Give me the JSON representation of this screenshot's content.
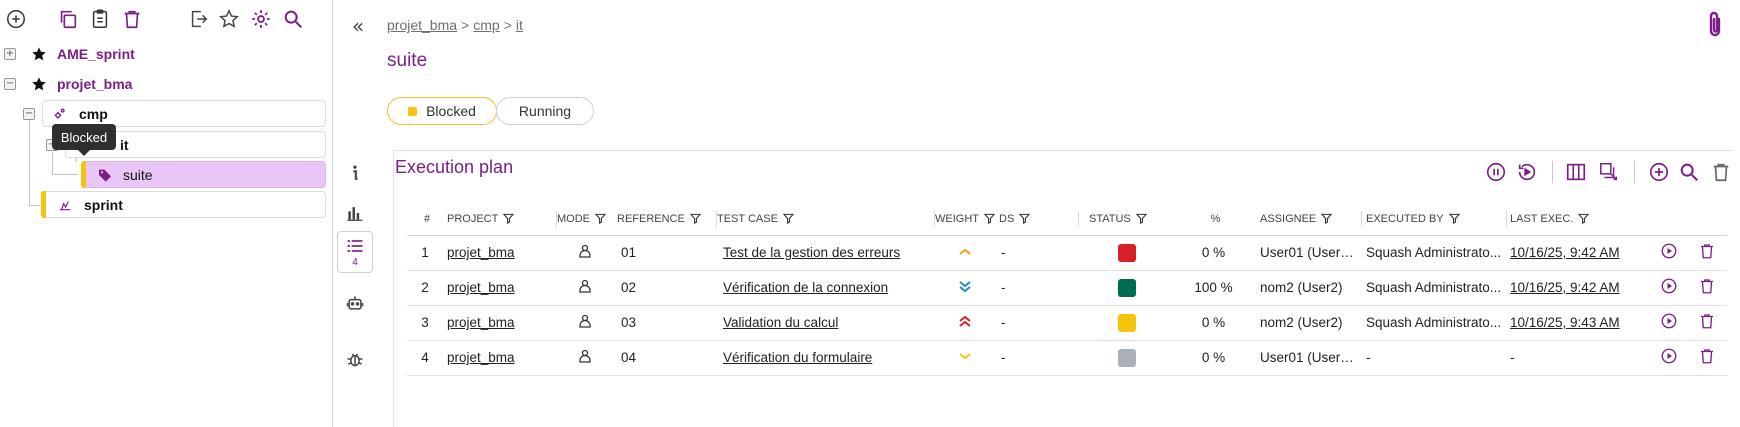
{
  "tree": {
    "projects": [
      {
        "name": "AME_sprint",
        "expander": "+"
      },
      {
        "name": "projet_bma",
        "expander": "−"
      }
    ],
    "nodes": {
      "cmp": "cmp",
      "it": "it",
      "suite": "suite",
      "sprint": "sprint"
    },
    "tooltip": "Blocked"
  },
  "breadcrumb": {
    "items": [
      "projet_bma",
      "cmp",
      "it"
    ],
    "separator": ">"
  },
  "page_title": "suite",
  "status_toggle": {
    "blocked": "Blocked",
    "running": "Running"
  },
  "side_nav": {
    "plan_count": "4"
  },
  "execution_plan": {
    "title": "Execution plan",
    "columns": {
      "num": "#",
      "project": "Project",
      "mode": "Mode",
      "reference": "Reference",
      "test_case": "Test case",
      "weight": "Weight",
      "ds": "DS",
      "status": "Status",
      "percent": "%",
      "assignee": "Assignee",
      "executed_by": "Executed by",
      "last_exec": "Last exec."
    },
    "rows": [
      {
        "num": "1",
        "project": "projet_bma",
        "reference": "01",
        "test_case": "Test de la gestion des erreurs",
        "weight": "medium",
        "ds": "-",
        "status_color": "#d61f26",
        "percent": "0 %",
        "assignee": "User01 (User01)",
        "executed_by": "Squash Administrato...",
        "last_exec": "10/16/25, 9:42 AM"
      },
      {
        "num": "2",
        "project": "projet_bma",
        "reference": "02",
        "test_case": "Vérification de la connexion",
        "weight": "low",
        "ds": "-",
        "status_color": "#006b4f",
        "percent": "100 %",
        "assignee": "nom2 (User2)",
        "executed_by": "Squash Administrato...",
        "last_exec": "10/16/25, 9:42 AM"
      },
      {
        "num": "3",
        "project": "projet_bma",
        "reference": "03",
        "test_case": "Validation du calcul",
        "weight": "very-high",
        "ds": "-",
        "status_color": "#f6c40c",
        "percent": "0 %",
        "assignee": "nom2 (User2)",
        "executed_by": "Squash Administrato...",
        "last_exec": "10/16/25, 9:43 AM"
      },
      {
        "num": "4",
        "project": "projet_bma",
        "reference": "04",
        "test_case": "Vérification du formulaire",
        "weight": "very-low",
        "ds": "-",
        "status_color": "#a9b1b8",
        "percent": "0 %",
        "assignee": "User01 (User01)",
        "executed_by": "-",
        "last_exec": "-"
      }
    ]
  },
  "colors": {
    "brand": "#7b1f87",
    "selected_node": "#e9c6f5",
    "blocked": "#f6c40c"
  },
  "icons": {
    "toolbar": [
      "add-circle-icon",
      "copy-icon",
      "paste-icon",
      "trash-icon",
      "export-icon",
      "star-icon",
      "gear-icon",
      "search-icon"
    ],
    "side_nav": [
      "info-icon",
      "chart-icon",
      "list-icon",
      "robot-icon",
      "bug-icon"
    ],
    "plan_actions": [
      "pause-icon",
      "replay-icon",
      "columns-icon",
      "multi-select-icon",
      "add-icon",
      "search-icon",
      "trash-icon"
    ]
  }
}
